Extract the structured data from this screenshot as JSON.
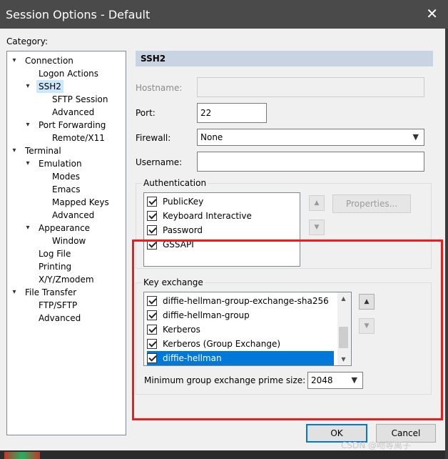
{
  "window": {
    "title": "Session Options - Default",
    "close_glyph": "✕"
  },
  "category_label": "Category:",
  "tree": [
    {
      "label": "Connection",
      "level": 0,
      "expander": "▾"
    },
    {
      "label": "Logon Actions",
      "level": 1,
      "expander": ""
    },
    {
      "label": "SSH2",
      "level": 1,
      "expander": "▾",
      "selected": true
    },
    {
      "label": "SFTP Session",
      "level": 2,
      "expander": ""
    },
    {
      "label": "Advanced",
      "level": 2,
      "expander": ""
    },
    {
      "label": "Port Forwarding",
      "level": 1,
      "expander": "▾"
    },
    {
      "label": "Remote/X11",
      "level": 2,
      "expander": ""
    },
    {
      "label": "Terminal",
      "level": 0,
      "expander": "▾"
    },
    {
      "label": "Emulation",
      "level": 1,
      "expander": "▾"
    },
    {
      "label": "Modes",
      "level": 2,
      "expander": ""
    },
    {
      "label": "Emacs",
      "level": 2,
      "expander": ""
    },
    {
      "label": "Mapped Keys",
      "level": 2,
      "expander": ""
    },
    {
      "label": "Advanced",
      "level": 2,
      "expander": ""
    },
    {
      "label": "Appearance",
      "level": 1,
      "expander": "▾"
    },
    {
      "label": "Window",
      "level": 2,
      "expander": ""
    },
    {
      "label": "Log File",
      "level": 1,
      "expander": ""
    },
    {
      "label": "Printing",
      "level": 1,
      "expander": ""
    },
    {
      "label": "X/Y/Zmodem",
      "level": 1,
      "expander": ""
    },
    {
      "label": "File Transfer",
      "level": 0,
      "expander": "▾"
    },
    {
      "label": "FTP/SFTP",
      "level": 1,
      "expander": ""
    },
    {
      "label": "Advanced",
      "level": 1,
      "expander": ""
    }
  ],
  "section_title": "SSH2",
  "form": {
    "hostname_label": "Hostname:",
    "hostname_value": "",
    "port_label": "Port:",
    "port_value": "22",
    "firewall_label": "Firewall:",
    "firewall_value": "None",
    "username_label": "Username:",
    "username_value": ""
  },
  "authentication": {
    "title": "Authentication",
    "items": [
      "PublicKey",
      "Keyboard Interactive",
      "Password",
      "GSSAPI"
    ],
    "properties_label": "Properties..."
  },
  "key_exchange": {
    "title": "Key exchange",
    "items": [
      {
        "label": "diffie-hellman-group-exchange-sha256",
        "highlighted": false
      },
      {
        "label": "diffie-hellman-group",
        "highlighted": false
      },
      {
        "label": "Kerberos",
        "highlighted": false
      },
      {
        "label": "Kerberos (Group Exchange)",
        "highlighted": false
      },
      {
        "label": "diffie-hellman",
        "highlighted": true
      }
    ],
    "min_prime_label": "Minimum group exchange prime size:",
    "min_prime_value": "2048"
  },
  "buttons": {
    "ok": "OK",
    "cancel": "Cancel"
  },
  "watermark": "CSDN @吻等离子",
  "colors": {
    "selection": "#0078d7",
    "annotation_box": "#ee1c1c",
    "section_header": "#c8d4e2"
  }
}
